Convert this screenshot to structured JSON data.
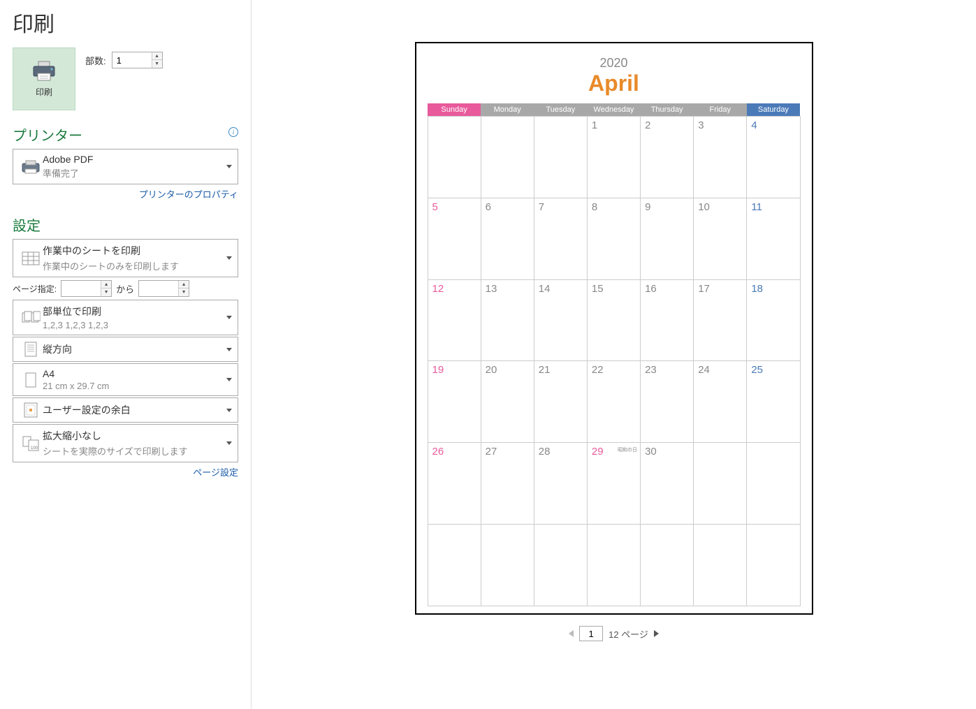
{
  "title": "印刷",
  "printButton": {
    "label": "印刷"
  },
  "copies": {
    "label": "部数:",
    "value": "1"
  },
  "printerSection": {
    "title": "プリンター"
  },
  "printer": {
    "name": "Adobe PDF",
    "status": "準備完了"
  },
  "printerPropsLink": "プリンターのプロパティ",
  "settingsSection": {
    "title": "設定"
  },
  "settings": {
    "printWhat": {
      "title": "作業中のシートを印刷",
      "sub": "作業中のシートのみを印刷します"
    },
    "pageRange": {
      "label": "ページ指定:",
      "from": "",
      "to": "",
      "toLabel": "から"
    },
    "collate": {
      "title": "部単位で印刷",
      "sub": "1,2,3    1,2,3    1,2,3"
    },
    "orientation": {
      "title": "縦方向"
    },
    "paper": {
      "title": "A4",
      "sub": "21 cm x 29.7 cm"
    },
    "margins": {
      "title": "ユーザー設定の余白"
    },
    "scaling": {
      "title": "拡大縮小なし",
      "sub": "シートを実際のサイズで印刷します"
    }
  },
  "pageSetupLink": "ページ設定",
  "pager": {
    "current": "1",
    "total": "12 ページ"
  },
  "calendar": {
    "year": "2020",
    "month": "April",
    "weekdays": [
      "Sunday",
      "Monday",
      "Tuesday",
      "Wednesday",
      "Thursday",
      "Friday",
      "Saturday"
    ],
    "weeks": [
      [
        {
          "d": ""
        },
        {
          "d": ""
        },
        {
          "d": ""
        },
        {
          "d": "1"
        },
        {
          "d": "2"
        },
        {
          "d": "3"
        },
        {
          "d": "4"
        }
      ],
      [
        {
          "d": "5"
        },
        {
          "d": "6"
        },
        {
          "d": "7"
        },
        {
          "d": "8"
        },
        {
          "d": "9"
        },
        {
          "d": "10"
        },
        {
          "d": "11"
        }
      ],
      [
        {
          "d": "12"
        },
        {
          "d": "13"
        },
        {
          "d": "14"
        },
        {
          "d": "15"
        },
        {
          "d": "16"
        },
        {
          "d": "17"
        },
        {
          "d": "18"
        }
      ],
      [
        {
          "d": "19"
        },
        {
          "d": "20"
        },
        {
          "d": "21"
        },
        {
          "d": "22"
        },
        {
          "d": "23"
        },
        {
          "d": "24"
        },
        {
          "d": "25"
        }
      ],
      [
        {
          "d": "26"
        },
        {
          "d": "27"
        },
        {
          "d": "28"
        },
        {
          "d": "29",
          "hol": "昭和の日"
        },
        {
          "d": "30"
        },
        {
          "d": ""
        },
        {
          "d": ""
        }
      ],
      [
        {
          "d": ""
        },
        {
          "d": ""
        },
        {
          "d": ""
        },
        {
          "d": ""
        },
        {
          "d": ""
        },
        {
          "d": ""
        },
        {
          "d": ""
        }
      ]
    ]
  }
}
